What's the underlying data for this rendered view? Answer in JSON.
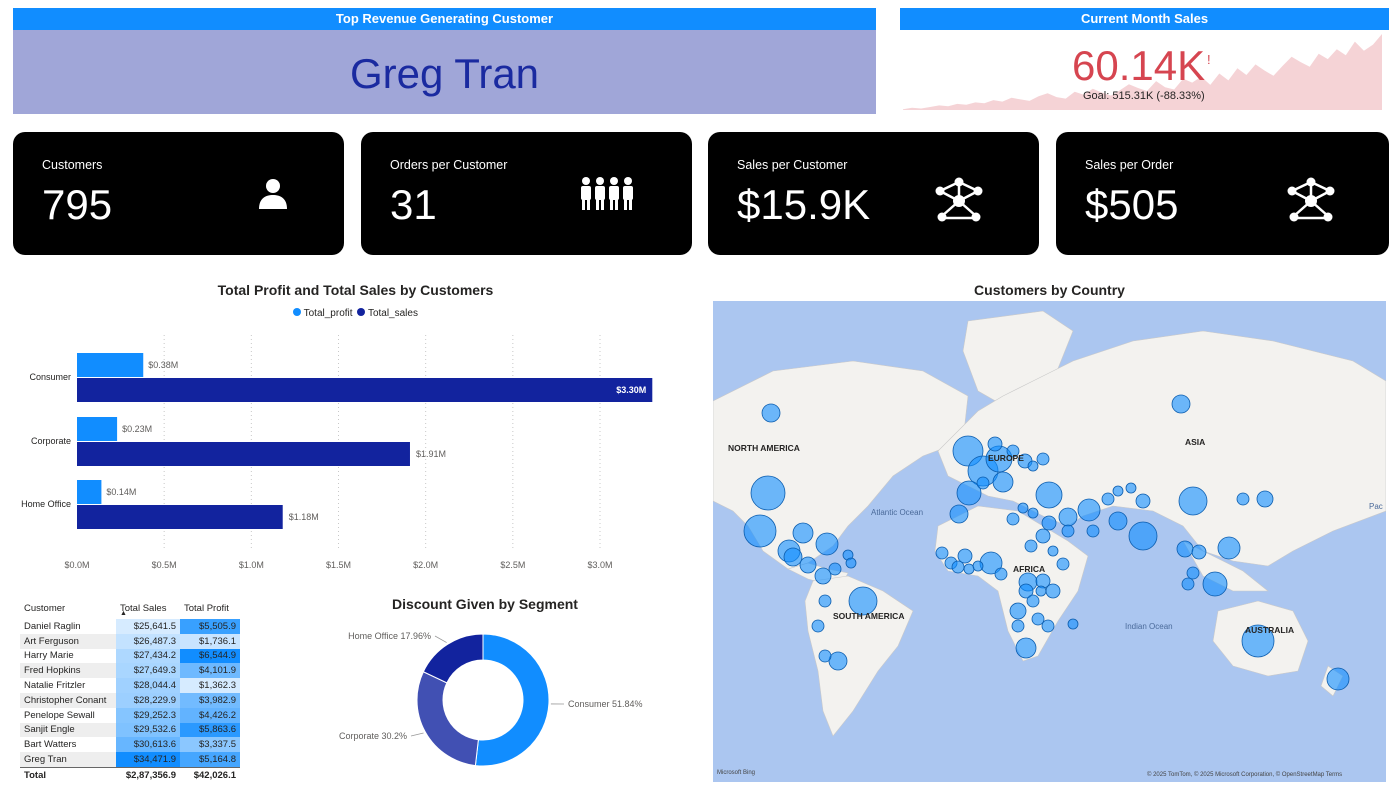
{
  "top_customer": {
    "header": "Top Revenue Generating Customer",
    "name": "Greg Tran"
  },
  "current_month": {
    "header": "Current Month Sales",
    "value": "60.14K",
    "alert": "!",
    "goal": "Goal: 515.31K (-88.33%)",
    "trend": [
      1,
      3,
      2,
      4,
      6,
      5,
      8,
      7,
      10,
      9,
      13,
      11,
      16,
      14,
      12,
      18,
      22,
      17,
      15,
      24,
      20,
      28,
      23,
      19,
      26,
      34,
      29,
      25,
      38,
      30,
      27,
      41,
      36,
      44,
      33,
      48,
      39,
      55,
      46,
      60,
      52,
      45,
      58,
      70,
      63,
      57,
      74,
      67,
      80,
      72,
      90,
      78,
      86,
      100
    ]
  },
  "kpis": [
    {
      "label": "Customers",
      "value": "795",
      "icon": "person-icon"
    },
    {
      "label": "Orders per Customer",
      "value": "31",
      "icon": "group-icon"
    },
    {
      "label": "Sales per Customer",
      "value": "$15.9K",
      "icon": "network-icon"
    },
    {
      "label": "Sales per Order",
      "value": "$505",
      "icon": "network-icon"
    }
  ],
  "chart_data": [
    {
      "type": "bar",
      "title": "Total Profit and Total Sales by Customers",
      "orientation": "horizontal",
      "categories": [
        "Consumer",
        "Corporate",
        "Home Office"
      ],
      "series": [
        {
          "name": "Total_profit",
          "values": [
            0.38,
            0.23,
            0.14
          ],
          "labels": [
            "$0.38M",
            "$0.23M",
            "$0.14M"
          ],
          "color": "#118dff"
        },
        {
          "name": "Total_sales",
          "values": [
            3.3,
            1.91,
            1.18
          ],
          "labels": [
            "$3.30M",
            "$1.91M",
            "$1.18M"
          ],
          "color": "#12239e"
        }
      ],
      "xticks": [
        "$0.0M",
        "$0.5M",
        "$1.0M",
        "$1.5M",
        "$2.0M",
        "$2.5M",
        "$3.0M"
      ],
      "xlim": [
        0,
        3.3
      ],
      "legend": "top-center",
      "grid": true
    },
    {
      "type": "pie",
      "title": "Discount Given by Segment",
      "donut": true,
      "labels": [
        "Consumer",
        "Corporate",
        "Home Office"
      ],
      "values": [
        51.84,
        30.2,
        17.96
      ],
      "slice_labels": [
        "Consumer 51.84%",
        "Corporate 30.2%",
        "Home Office 17.96%"
      ],
      "colors": [
        "#118dff",
        "#4150b3",
        "#12239e"
      ]
    },
    {
      "type": "table",
      "columns": [
        "Customer",
        "Total Sales",
        "Total Profit"
      ],
      "rows": [
        [
          "Daniel Raglin",
          "$25,641.5",
          "$5,505.9"
        ],
        [
          "Art Ferguson",
          "$26,487.3",
          "$1,736.1"
        ],
        [
          "Harry Marie",
          "$27,434.2",
          "$6,544.9"
        ],
        [
          "Fred Hopkins",
          "$27,649.3",
          "$4,101.9"
        ],
        [
          "Natalie Fritzler",
          "$28,044.4",
          "$1,362.3"
        ],
        [
          "Christopher Conant",
          "$28,229.9",
          "$3,982.9"
        ],
        [
          "Penelope Sewall",
          "$29,252.3",
          "$4,426.2"
        ],
        [
          "Sanjit Engle",
          "$29,532.6",
          "$5,863.6"
        ],
        [
          "Bart Watters",
          "$30,613.6",
          "$3,337.5"
        ],
        [
          "Greg Tran",
          "$34,471.9",
          "$5,164.8"
        ]
      ],
      "total": [
        "Total",
        "$2,87,356.9",
        "$42,026.1"
      ],
      "sales_values": [
        25641.5,
        26487.3,
        27434.2,
        27649.3,
        28044.4,
        28229.9,
        29252.3,
        29532.6,
        30613.6,
        34471.9
      ],
      "profit_values": [
        5505.9,
        1736.1,
        6544.9,
        4101.9,
        1362.3,
        3982.9,
        4426.2,
        5863.6,
        3337.5,
        5164.8
      ]
    }
  ],
  "map": {
    "title": "Customers by Country",
    "labels": [
      "NORTH AMERICA",
      "EUROPE",
      "ASIA",
      "AFRICA",
      "SOUTH AMERICA",
      "AUSTRALIA",
      "Atlantic Ocean",
      "Indian Ocean",
      "Pac"
    ],
    "attribution": "© 2025 TomTom, © 2025 Microsoft Corporation, © OpenStreetMap  Terms",
    "logo": "Microsoft Bing"
  }
}
